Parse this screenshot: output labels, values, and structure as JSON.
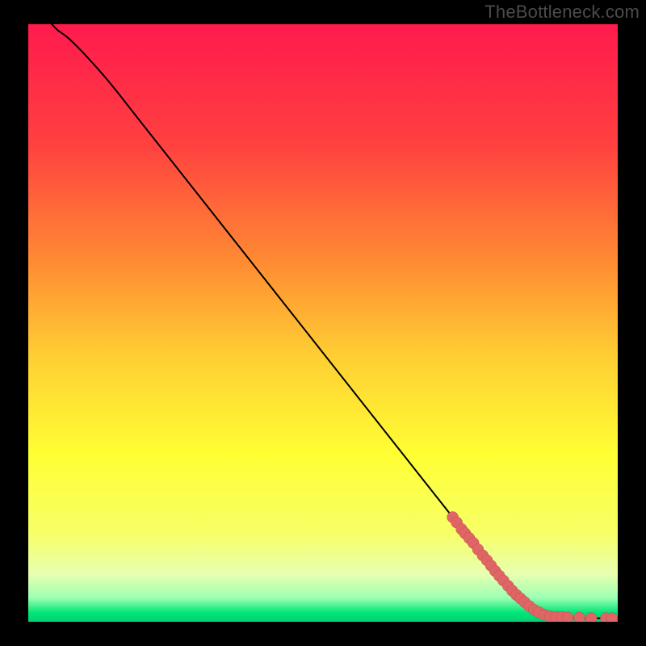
{
  "watermark": "TheBottleneck.com",
  "colors": {
    "background": "#000000",
    "gradient_stops": [
      {
        "offset": 0.0,
        "color": "#ff1a4d"
      },
      {
        "offset": 0.2,
        "color": "#ff4040"
      },
      {
        "offset": 0.4,
        "color": "#ff8c33"
      },
      {
        "offset": 0.55,
        "color": "#ffcc33"
      },
      {
        "offset": 0.72,
        "color": "#ffff33"
      },
      {
        "offset": 0.85,
        "color": "#f7ff66"
      },
      {
        "offset": 0.92,
        "color": "#e8ffb0"
      },
      {
        "offset": 0.96,
        "color": "#9cffb3"
      },
      {
        "offset": 0.985,
        "color": "#00e676"
      },
      {
        "offset": 1.0,
        "color": "#00d173"
      }
    ],
    "curve": "#000000",
    "marker_fill": "#e06666",
    "marker_stroke": "#c05050"
  },
  "chart_data": {
    "type": "line",
    "title": "",
    "xlabel": "",
    "ylabel": "",
    "xlim": [
      0,
      100
    ],
    "ylim": [
      0,
      100
    ],
    "curve": [
      {
        "x": 4.0,
        "y": 100.0
      },
      {
        "x": 5.0,
        "y": 99.0
      },
      {
        "x": 7.0,
        "y": 97.5
      },
      {
        "x": 10.0,
        "y": 94.5
      },
      {
        "x": 14.0,
        "y": 90.0
      },
      {
        "x": 20.0,
        "y": 82.5
      },
      {
        "x": 30.0,
        "y": 70.0
      },
      {
        "x": 40.0,
        "y": 57.5
      },
      {
        "x": 50.0,
        "y": 45.0
      },
      {
        "x": 60.0,
        "y": 32.5
      },
      {
        "x": 70.0,
        "y": 20.0
      },
      {
        "x": 76.0,
        "y": 12.5
      },
      {
        "x": 80.0,
        "y": 7.5
      },
      {
        "x": 84.0,
        "y": 3.5
      },
      {
        "x": 87.0,
        "y": 1.5
      },
      {
        "x": 90.0,
        "y": 0.8
      },
      {
        "x": 95.0,
        "y": 0.6
      },
      {
        "x": 100.0,
        "y": 0.6
      }
    ],
    "markers": [
      {
        "x": 72.0,
        "y": 17.5
      },
      {
        "x": 72.7,
        "y": 16.6
      },
      {
        "x": 73.5,
        "y": 15.5
      },
      {
        "x": 74.1,
        "y": 14.8
      },
      {
        "x": 74.8,
        "y": 14.0
      },
      {
        "x": 75.5,
        "y": 13.2
      },
      {
        "x": 76.3,
        "y": 12.1
      },
      {
        "x": 77.1,
        "y": 11.1
      },
      {
        "x": 77.8,
        "y": 10.3
      },
      {
        "x": 78.5,
        "y": 9.4
      },
      {
        "x": 79.2,
        "y": 8.5
      },
      {
        "x": 79.9,
        "y": 7.7
      },
      {
        "x": 80.6,
        "y": 6.9
      },
      {
        "x": 81.4,
        "y": 6.0
      },
      {
        "x": 82.1,
        "y": 5.2
      },
      {
        "x": 82.8,
        "y": 4.5
      },
      {
        "x": 83.5,
        "y": 3.9
      },
      {
        "x": 84.2,
        "y": 3.3
      },
      {
        "x": 85.0,
        "y": 2.6
      },
      {
        "x": 85.8,
        "y": 2.0
      },
      {
        "x": 86.6,
        "y": 1.6
      },
      {
        "x": 87.5,
        "y": 1.2
      },
      {
        "x": 88.5,
        "y": 0.9
      },
      {
        "x": 89.5,
        "y": 0.8
      },
      {
        "x": 90.5,
        "y": 0.8
      },
      {
        "x": 91.5,
        "y": 0.7
      },
      {
        "x": 93.5,
        "y": 0.7
      },
      {
        "x": 95.5,
        "y": 0.6
      },
      {
        "x": 98.0,
        "y": 0.6
      },
      {
        "x": 99.0,
        "y": 0.6
      }
    ],
    "marker_radius_px": 7
  }
}
